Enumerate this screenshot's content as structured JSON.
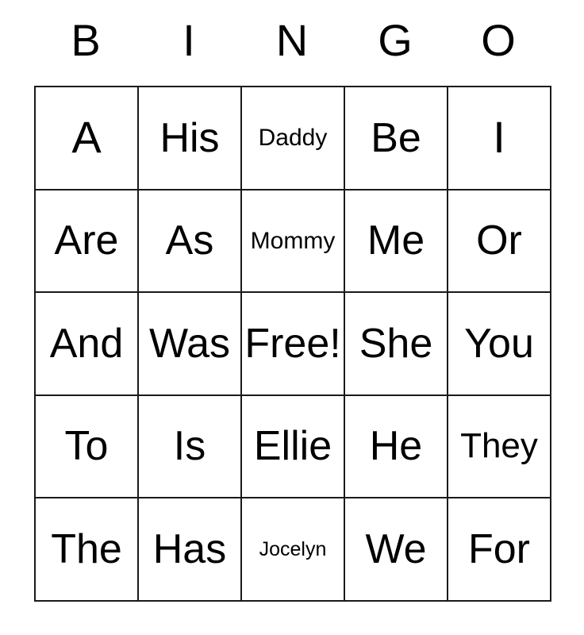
{
  "card": {
    "headers": [
      "B",
      "I",
      "N",
      "G",
      "O"
    ],
    "rows": [
      [
        {
          "text": "A",
          "size": "xl"
        },
        {
          "text": "His",
          "size": "lg"
        },
        {
          "text": "Daddy",
          "size": "sm"
        },
        {
          "text": "Be",
          "size": "lg"
        },
        {
          "text": "I",
          "size": "xl"
        }
      ],
      [
        {
          "text": "Are",
          "size": "lg"
        },
        {
          "text": "As",
          "size": "lg"
        },
        {
          "text": "Mommy",
          "size": "sm"
        },
        {
          "text": "Me",
          "size": "lg"
        },
        {
          "text": "Or",
          "size": "lg"
        }
      ],
      [
        {
          "text": "And",
          "size": "lg"
        },
        {
          "text": "Was",
          "size": "lg"
        },
        {
          "text": "Free!",
          "size": "lg"
        },
        {
          "text": "She",
          "size": "lg"
        },
        {
          "text": "You",
          "size": "lg"
        }
      ],
      [
        {
          "text": "To",
          "size": "lg"
        },
        {
          "text": "Is",
          "size": "lg"
        },
        {
          "text": "Ellie",
          "size": "lg"
        },
        {
          "text": "He",
          "size": "lg"
        },
        {
          "text": "They",
          "size": "md"
        }
      ],
      [
        {
          "text": "The",
          "size": "lg"
        },
        {
          "text": "Has",
          "size": "lg"
        },
        {
          "text": "Jocelyn",
          "size": "xs"
        },
        {
          "text": "We",
          "size": "lg"
        },
        {
          "text": "For",
          "size": "lg"
        }
      ]
    ],
    "free_space_text": "Free!",
    "colors": {
      "background": "#ffffff",
      "text": "#000000",
      "border": "#1a1a1a"
    }
  }
}
